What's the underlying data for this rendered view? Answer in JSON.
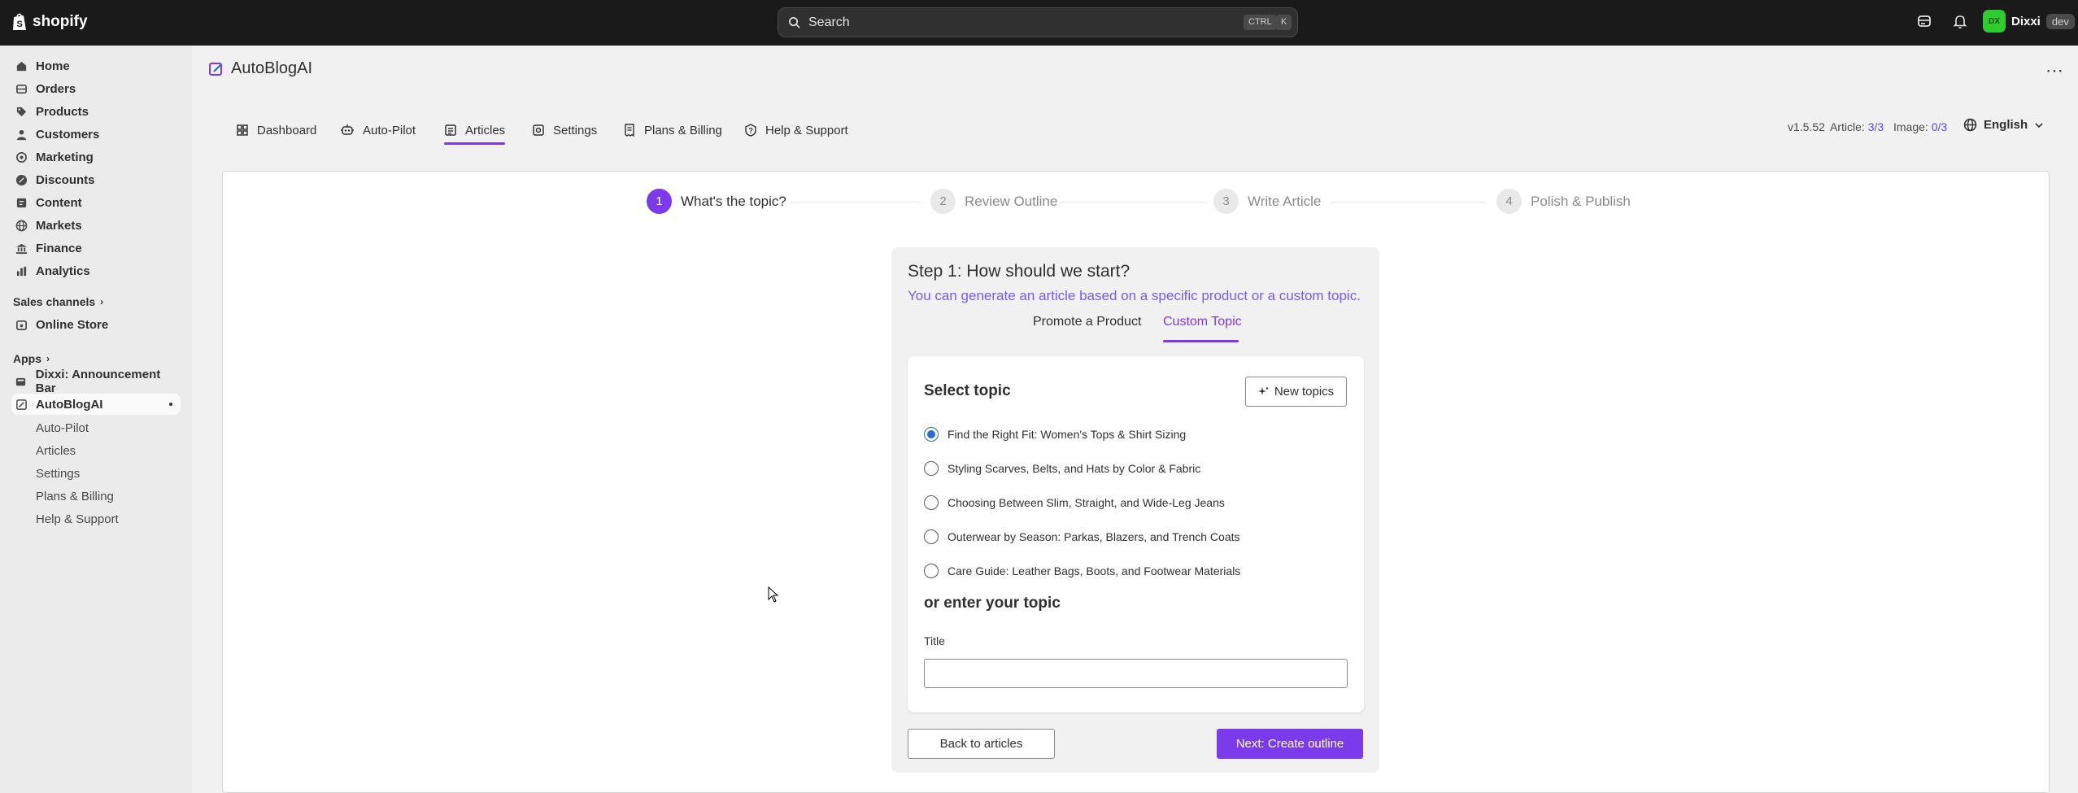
{
  "topbar": {
    "logo_text": "shopify",
    "search_placeholder": "Search",
    "shortcut_ctrl": "CTRL",
    "shortcut_key": "K",
    "user_initials": "DX",
    "user_name": "Dixxi",
    "user_badge": "dev"
  },
  "sidebar": {
    "items": [
      {
        "label": "Home",
        "icon": "home-icon"
      },
      {
        "label": "Orders",
        "icon": "orders-icon"
      },
      {
        "label": "Products",
        "icon": "tag-icon"
      },
      {
        "label": "Customers",
        "icon": "person-icon"
      },
      {
        "label": "Marketing",
        "icon": "target-icon"
      },
      {
        "label": "Discounts",
        "icon": "discount-icon"
      },
      {
        "label": "Content",
        "icon": "content-icon"
      },
      {
        "label": "Markets",
        "icon": "globe-icon"
      },
      {
        "label": "Finance",
        "icon": "bank-icon"
      },
      {
        "label": "Analytics",
        "icon": "chart-icon"
      }
    ],
    "sales_channels_label": "Sales channels",
    "online_store_label": "Online Store",
    "apps_label": "Apps",
    "app1_label": "Dixxi: Announcement Bar",
    "app2_label": "AutoBlogAI",
    "subitems": [
      "Auto-Pilot",
      "Articles",
      "Settings",
      "Plans & Billing",
      "Help & Support"
    ]
  },
  "app": {
    "title": "AutoBlogAI",
    "tabs": [
      {
        "label": "Dashboard",
        "icon": "dashboard-icon"
      },
      {
        "label": "Auto-Pilot",
        "icon": "robot-icon"
      },
      {
        "label": "Articles",
        "icon": "article-icon"
      },
      {
        "label": "Settings",
        "icon": "gear-icon"
      },
      {
        "label": "Plans & Billing",
        "icon": "receipt-icon"
      },
      {
        "label": "Help & Support",
        "icon": "help-icon"
      }
    ],
    "active_tab": "Articles",
    "version": "v1.5.52",
    "article_label": "Article:",
    "article_count": "3/3",
    "image_label": "Image:",
    "image_count": "0/3",
    "language": "English"
  },
  "stepper": [
    {
      "num": "1",
      "label": "What's the topic?"
    },
    {
      "num": "2",
      "label": "Review Outline"
    },
    {
      "num": "3",
      "label": "Write Article"
    },
    {
      "num": "4",
      "label": "Polish & Publish"
    }
  ],
  "step_panel": {
    "title": "Step 1: How should we start?",
    "subtitle": "You can generate an article based on a specific product or a custom topic.",
    "tab_product": "Promote a Product",
    "tab_custom": "Custom Topic",
    "active_tab": "Custom Topic",
    "select_topic_heading": "Select topic",
    "new_topics_button": "New topics",
    "topics": [
      "Find the Right Fit: Women's Tops & Shirt Sizing",
      "Styling Scarves, Belts, and Hats by Color & Fabric",
      "Choosing Between Slim, Straight, and Wide-Leg Jeans",
      "Outerwear by Season: Parkas, Blazers, and Trench Coats",
      "Care Guide: Leather Bags, Boots, and Footwear Materials"
    ],
    "selected_topic_index": 0,
    "or_enter_heading": "or enter your topic",
    "title_field_label": "Title",
    "title_field_value": "",
    "back_button": "Back to articles",
    "next_button": "Next: Create outline"
  },
  "colors": {
    "accent": "#7c3aed",
    "topbar_bg": "#1a1a1a",
    "sidebar_bg": "#ebebeb",
    "radio_selected": "#2c6ecb"
  }
}
